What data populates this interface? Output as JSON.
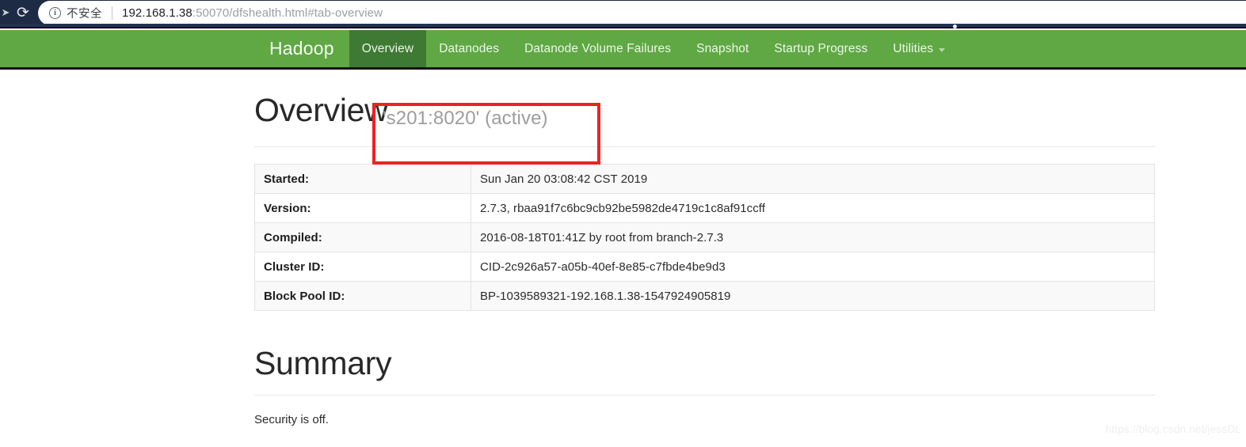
{
  "browser": {
    "forward_icon": "forward-arrow-icon",
    "reload_icon": "reload-icon",
    "info_icon": "ⓘ",
    "security_label": "不安全",
    "url_host": "192.168.1.38",
    "url_rest": ":50070/dfshealth.html#tab-overview",
    "url_full": "192.168.1.38:50070/dfshealth.html#tab-overview"
  },
  "navbar": {
    "brand": "Hadoop",
    "background_color": "#5fa844",
    "active_color": "#3e7a33",
    "items": [
      {
        "label": "Overview",
        "active": true
      },
      {
        "label": "Datanodes",
        "active": false
      },
      {
        "label": "Datanode Volume Failures",
        "active": false
      },
      {
        "label": "Snapshot",
        "active": false
      },
      {
        "label": "Startup Progress",
        "active": false
      },
      {
        "label": "Utilities",
        "active": false,
        "has_caret": true
      }
    ]
  },
  "overview": {
    "title": "Overview",
    "subtitle": "'s201:8020' (active)",
    "annotation_color": "#ee2222",
    "table": {
      "rows": [
        {
          "key": "Started:",
          "value": "Sun Jan 20 03:08:42 CST 2019"
        },
        {
          "key": "Version:",
          "value": "2.7.3, rbaa91f7c6bc9cb92be5982de4719c1c8af91ccff"
        },
        {
          "key": "Compiled:",
          "value": "2016-08-18T01:41Z by root from branch-2.7.3"
        },
        {
          "key": "Cluster ID:",
          "value": "CID-2c926a57-a05b-40ef-8e85-c7fbde4be9d3"
        },
        {
          "key": "Block Pool ID:",
          "value": "BP-1039589321-192.168.1.38-1547924905819"
        }
      ]
    }
  },
  "summary": {
    "title": "Summary",
    "security_status": "Security is off."
  },
  "watermark": {
    "text": "https://blog.csdn.net/jessDL"
  }
}
